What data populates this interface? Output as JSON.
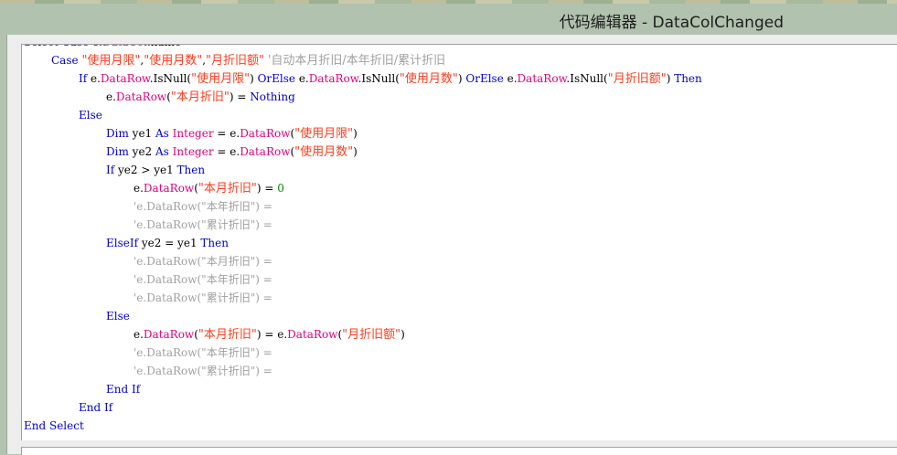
{
  "window": {
    "title": "代码编辑器 - DataColChanged"
  },
  "code_lines": [
    {
      "indent": 0,
      "tokens": [
        {
          "t": "Select Case",
          "c": "kw"
        },
        {
          "t": " e.",
          "c": "plain"
        },
        {
          "t": "DataCol",
          "c": "obj"
        },
        {
          "t": ".name",
          "c": "plain"
        }
      ]
    },
    {
      "indent": 1,
      "tokens": [
        {
          "t": "Case",
          "c": "kw"
        },
        {
          "t": " ",
          "c": "plain"
        },
        {
          "t": "\"使用月限\"",
          "c": "str"
        },
        {
          "t": ",",
          "c": "plain"
        },
        {
          "t": "\"使用月数\"",
          "c": "str"
        },
        {
          "t": ",",
          "c": "plain"
        },
        {
          "t": "\"月折旧额\"",
          "c": "str"
        },
        {
          "t": " ",
          "c": "plain"
        },
        {
          "t": "'自动本月折旧/本年折旧/累计折旧",
          "c": "cmt"
        }
      ]
    },
    {
      "indent": 2,
      "tokens": [
        {
          "t": "If",
          "c": "kw"
        },
        {
          "t": " e.",
          "c": "plain"
        },
        {
          "t": "DataRow",
          "c": "obj"
        },
        {
          "t": ".IsNull(",
          "c": "plain"
        },
        {
          "t": "\"使用月限\"",
          "c": "str"
        },
        {
          "t": ") ",
          "c": "plain"
        },
        {
          "t": "OrElse",
          "c": "kw"
        },
        {
          "t": " e.",
          "c": "plain"
        },
        {
          "t": "DataRow",
          "c": "obj"
        },
        {
          "t": ".IsNull(",
          "c": "plain"
        },
        {
          "t": "\"使用月数\"",
          "c": "str"
        },
        {
          "t": ") ",
          "c": "plain"
        },
        {
          "t": "OrElse",
          "c": "kw"
        },
        {
          "t": " e.",
          "c": "plain"
        },
        {
          "t": "DataRow",
          "c": "obj"
        },
        {
          "t": ".IsNull(",
          "c": "plain"
        },
        {
          "t": "\"月折旧额\"",
          "c": "str"
        },
        {
          "t": ") ",
          "c": "plain"
        },
        {
          "t": "Then",
          "c": "kw"
        }
      ]
    },
    {
      "indent": 3,
      "tokens": [
        {
          "t": "e.",
          "c": "plain"
        },
        {
          "t": "DataRow",
          "c": "obj"
        },
        {
          "t": "(",
          "c": "plain"
        },
        {
          "t": "\"本月折旧\"",
          "c": "str"
        },
        {
          "t": ") = ",
          "c": "plain"
        },
        {
          "t": "Nothing",
          "c": "kw"
        }
      ]
    },
    {
      "indent": 2,
      "tokens": [
        {
          "t": "Else",
          "c": "kw"
        }
      ]
    },
    {
      "indent": 3,
      "tokens": [
        {
          "t": "Dim",
          "c": "kw"
        },
        {
          "t": " ye1 ",
          "c": "plain"
        },
        {
          "t": "As",
          "c": "kw"
        },
        {
          "t": " ",
          "c": "plain"
        },
        {
          "t": "Integer",
          "c": "obj"
        },
        {
          "t": " = e.",
          "c": "plain"
        },
        {
          "t": "DataRow",
          "c": "obj"
        },
        {
          "t": "(",
          "c": "plain"
        },
        {
          "t": "\"使用月限\"",
          "c": "str"
        },
        {
          "t": ")",
          "c": "plain"
        }
      ]
    },
    {
      "indent": 3,
      "tokens": [
        {
          "t": "Dim",
          "c": "kw"
        },
        {
          "t": " ye2 ",
          "c": "plain"
        },
        {
          "t": "As",
          "c": "kw"
        },
        {
          "t": " ",
          "c": "plain"
        },
        {
          "t": "Integer",
          "c": "obj"
        },
        {
          "t": " = e.",
          "c": "plain"
        },
        {
          "t": "DataRow",
          "c": "obj"
        },
        {
          "t": "(",
          "c": "plain"
        },
        {
          "t": "\"使用月数\"",
          "c": "str"
        },
        {
          "t": ")",
          "c": "plain"
        }
      ]
    },
    {
      "indent": 3,
      "tokens": [
        {
          "t": "If",
          "c": "kw"
        },
        {
          "t": " ye2 > ye1 ",
          "c": "plain"
        },
        {
          "t": "Then",
          "c": "kw"
        }
      ]
    },
    {
      "indent": 4,
      "tokens": [
        {
          "t": "e.",
          "c": "plain"
        },
        {
          "t": "DataRow",
          "c": "obj"
        },
        {
          "t": "(",
          "c": "plain"
        },
        {
          "t": "\"本月折旧\"",
          "c": "str"
        },
        {
          "t": ") = ",
          "c": "plain"
        },
        {
          "t": "0",
          "c": "num"
        }
      ]
    },
    {
      "indent": 4,
      "tokens": [
        {
          "t": "'e.DataRow(\"本年折旧\") =",
          "c": "cmt"
        }
      ]
    },
    {
      "indent": 4,
      "tokens": [
        {
          "t": "'e.DataRow(\"累计折旧\") =",
          "c": "cmt"
        }
      ]
    },
    {
      "indent": 3,
      "tokens": [
        {
          "t": "ElseIf",
          "c": "kw"
        },
        {
          "t": " ye2 = ye1 ",
          "c": "plain"
        },
        {
          "t": "Then",
          "c": "kw"
        }
      ]
    },
    {
      "indent": 4,
      "tokens": [
        {
          "t": "'e.DataRow(\"本月折旧\") =",
          "c": "cmt"
        }
      ]
    },
    {
      "indent": 4,
      "tokens": [
        {
          "t": "'e.DataRow(\"本年折旧\") =",
          "c": "cmt"
        }
      ]
    },
    {
      "indent": 4,
      "tokens": [
        {
          "t": "'e.DataRow(\"累计折旧\") =",
          "c": "cmt"
        }
      ]
    },
    {
      "indent": 3,
      "tokens": [
        {
          "t": "Else",
          "c": "kw"
        }
      ]
    },
    {
      "indent": 4,
      "tokens": [
        {
          "t": "e.",
          "c": "plain"
        },
        {
          "t": "DataRow",
          "c": "obj"
        },
        {
          "t": "(",
          "c": "plain"
        },
        {
          "t": "\"本月折旧\"",
          "c": "str"
        },
        {
          "t": ") = e.",
          "c": "plain"
        },
        {
          "t": "DataRow",
          "c": "obj"
        },
        {
          "t": "(",
          "c": "plain"
        },
        {
          "t": "\"月折旧额\"",
          "c": "str"
        },
        {
          "t": ")",
          "c": "plain"
        }
      ]
    },
    {
      "indent": 4,
      "tokens": [
        {
          "t": "'e.DataRow(\"本年折旧\") =",
          "c": "cmt"
        }
      ]
    },
    {
      "indent": 4,
      "tokens": [
        {
          "t": "'e.DataRow(\"累计折旧\") =",
          "c": "cmt"
        }
      ]
    },
    {
      "indent": 3,
      "tokens": [
        {
          "t": "End If",
          "c": "kw"
        }
      ]
    },
    {
      "indent": 2,
      "tokens": [
        {
          "t": "End If",
          "c": "kw"
        }
      ]
    },
    {
      "indent": 0,
      "tokens": [
        {
          "t": "End Select",
          "c": "kw"
        }
      ]
    }
  ]
}
